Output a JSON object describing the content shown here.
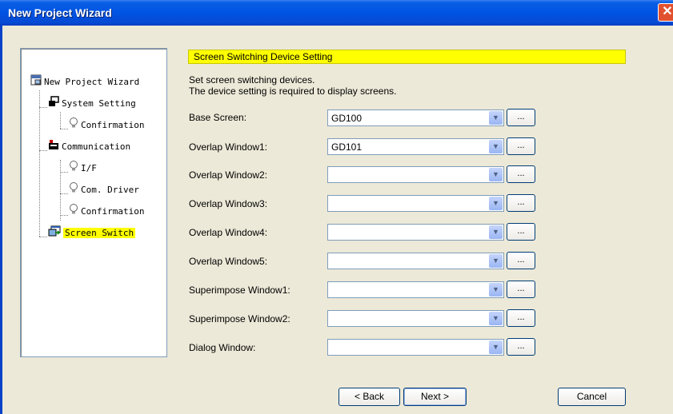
{
  "window": {
    "title": "New Project Wizard"
  },
  "tree": {
    "root": "New Project Wizard",
    "system_setting": "System Setting",
    "confirmation_1": "Confirmation",
    "communication": "Communication",
    "if": "I/F",
    "com_driver": "Com. Driver",
    "confirmation_2": "Confirmation",
    "screen_switch": "Screen Switch"
  },
  "panel": {
    "heading": "Screen Switching Device Setting",
    "desc_line1": "Set screen switching devices.",
    "desc_line2": "The device setting is required to display screens."
  },
  "rows": [
    {
      "label": "Base Screen:",
      "value": "GD100"
    },
    {
      "label": "Overlap Window1:",
      "value": "GD101"
    },
    {
      "label": "Overlap Window2:",
      "value": ""
    },
    {
      "label": "Overlap Window3:",
      "value": ""
    },
    {
      "label": "Overlap Window4:",
      "value": ""
    },
    {
      "label": "Overlap Window5:",
      "value": ""
    },
    {
      "label": "Superimpose Window1:",
      "value": ""
    },
    {
      "label": "Superimpose Window2:",
      "value": ""
    },
    {
      "label": "Dialog Window:",
      "value": ""
    }
  ],
  "browse_label": "...",
  "buttons": {
    "back": "< Back",
    "next": "Next >",
    "cancel": "Cancel"
  },
  "colors": {
    "titlebar": "#0054e3",
    "highlight": "#ffff00",
    "dialog_bg": "#ece9d8"
  }
}
